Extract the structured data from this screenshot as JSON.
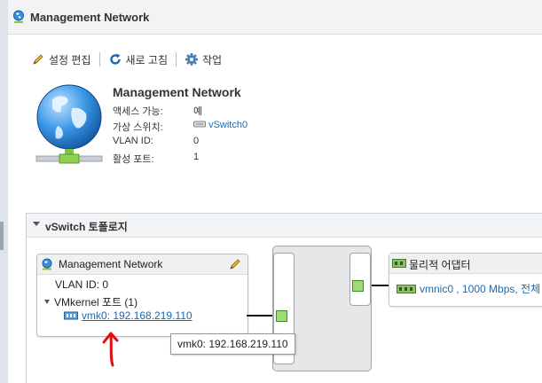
{
  "window": {
    "title": "Management Network"
  },
  "toolbar": {
    "edit_label": "설정 편집",
    "refresh_label": "새로 고침",
    "actions_label": "작업"
  },
  "network_info": {
    "title": "Management Network",
    "rows": [
      {
        "label": "액세스 가능:",
        "value": "예"
      },
      {
        "label": "가상 스위치:",
        "value": "vSwitch0"
      },
      {
        "label": "VLAN ID:",
        "value": "0"
      },
      {
        "label": "활성 포트:",
        "value": "1"
      }
    ]
  },
  "topology": {
    "section_title": "vSwitch 토폴로지",
    "port_group": {
      "title": "Management Network",
      "vlan": "VLAN ID: 0",
      "vmkernel_ports": "VMkernel 포트 (1)",
      "vmk_entry": "vmk0: 192.168.219.110"
    },
    "physical_adapters": {
      "title": "물리적 어댑터",
      "entry": "vmnic0 , 1000 Mbps, 전체"
    },
    "tooltip": "vmk0: 192.168.219.110"
  },
  "colors": {
    "link": "#1d68b3",
    "port_green": "#9fdc73",
    "annotation_red": "#e01010"
  }
}
